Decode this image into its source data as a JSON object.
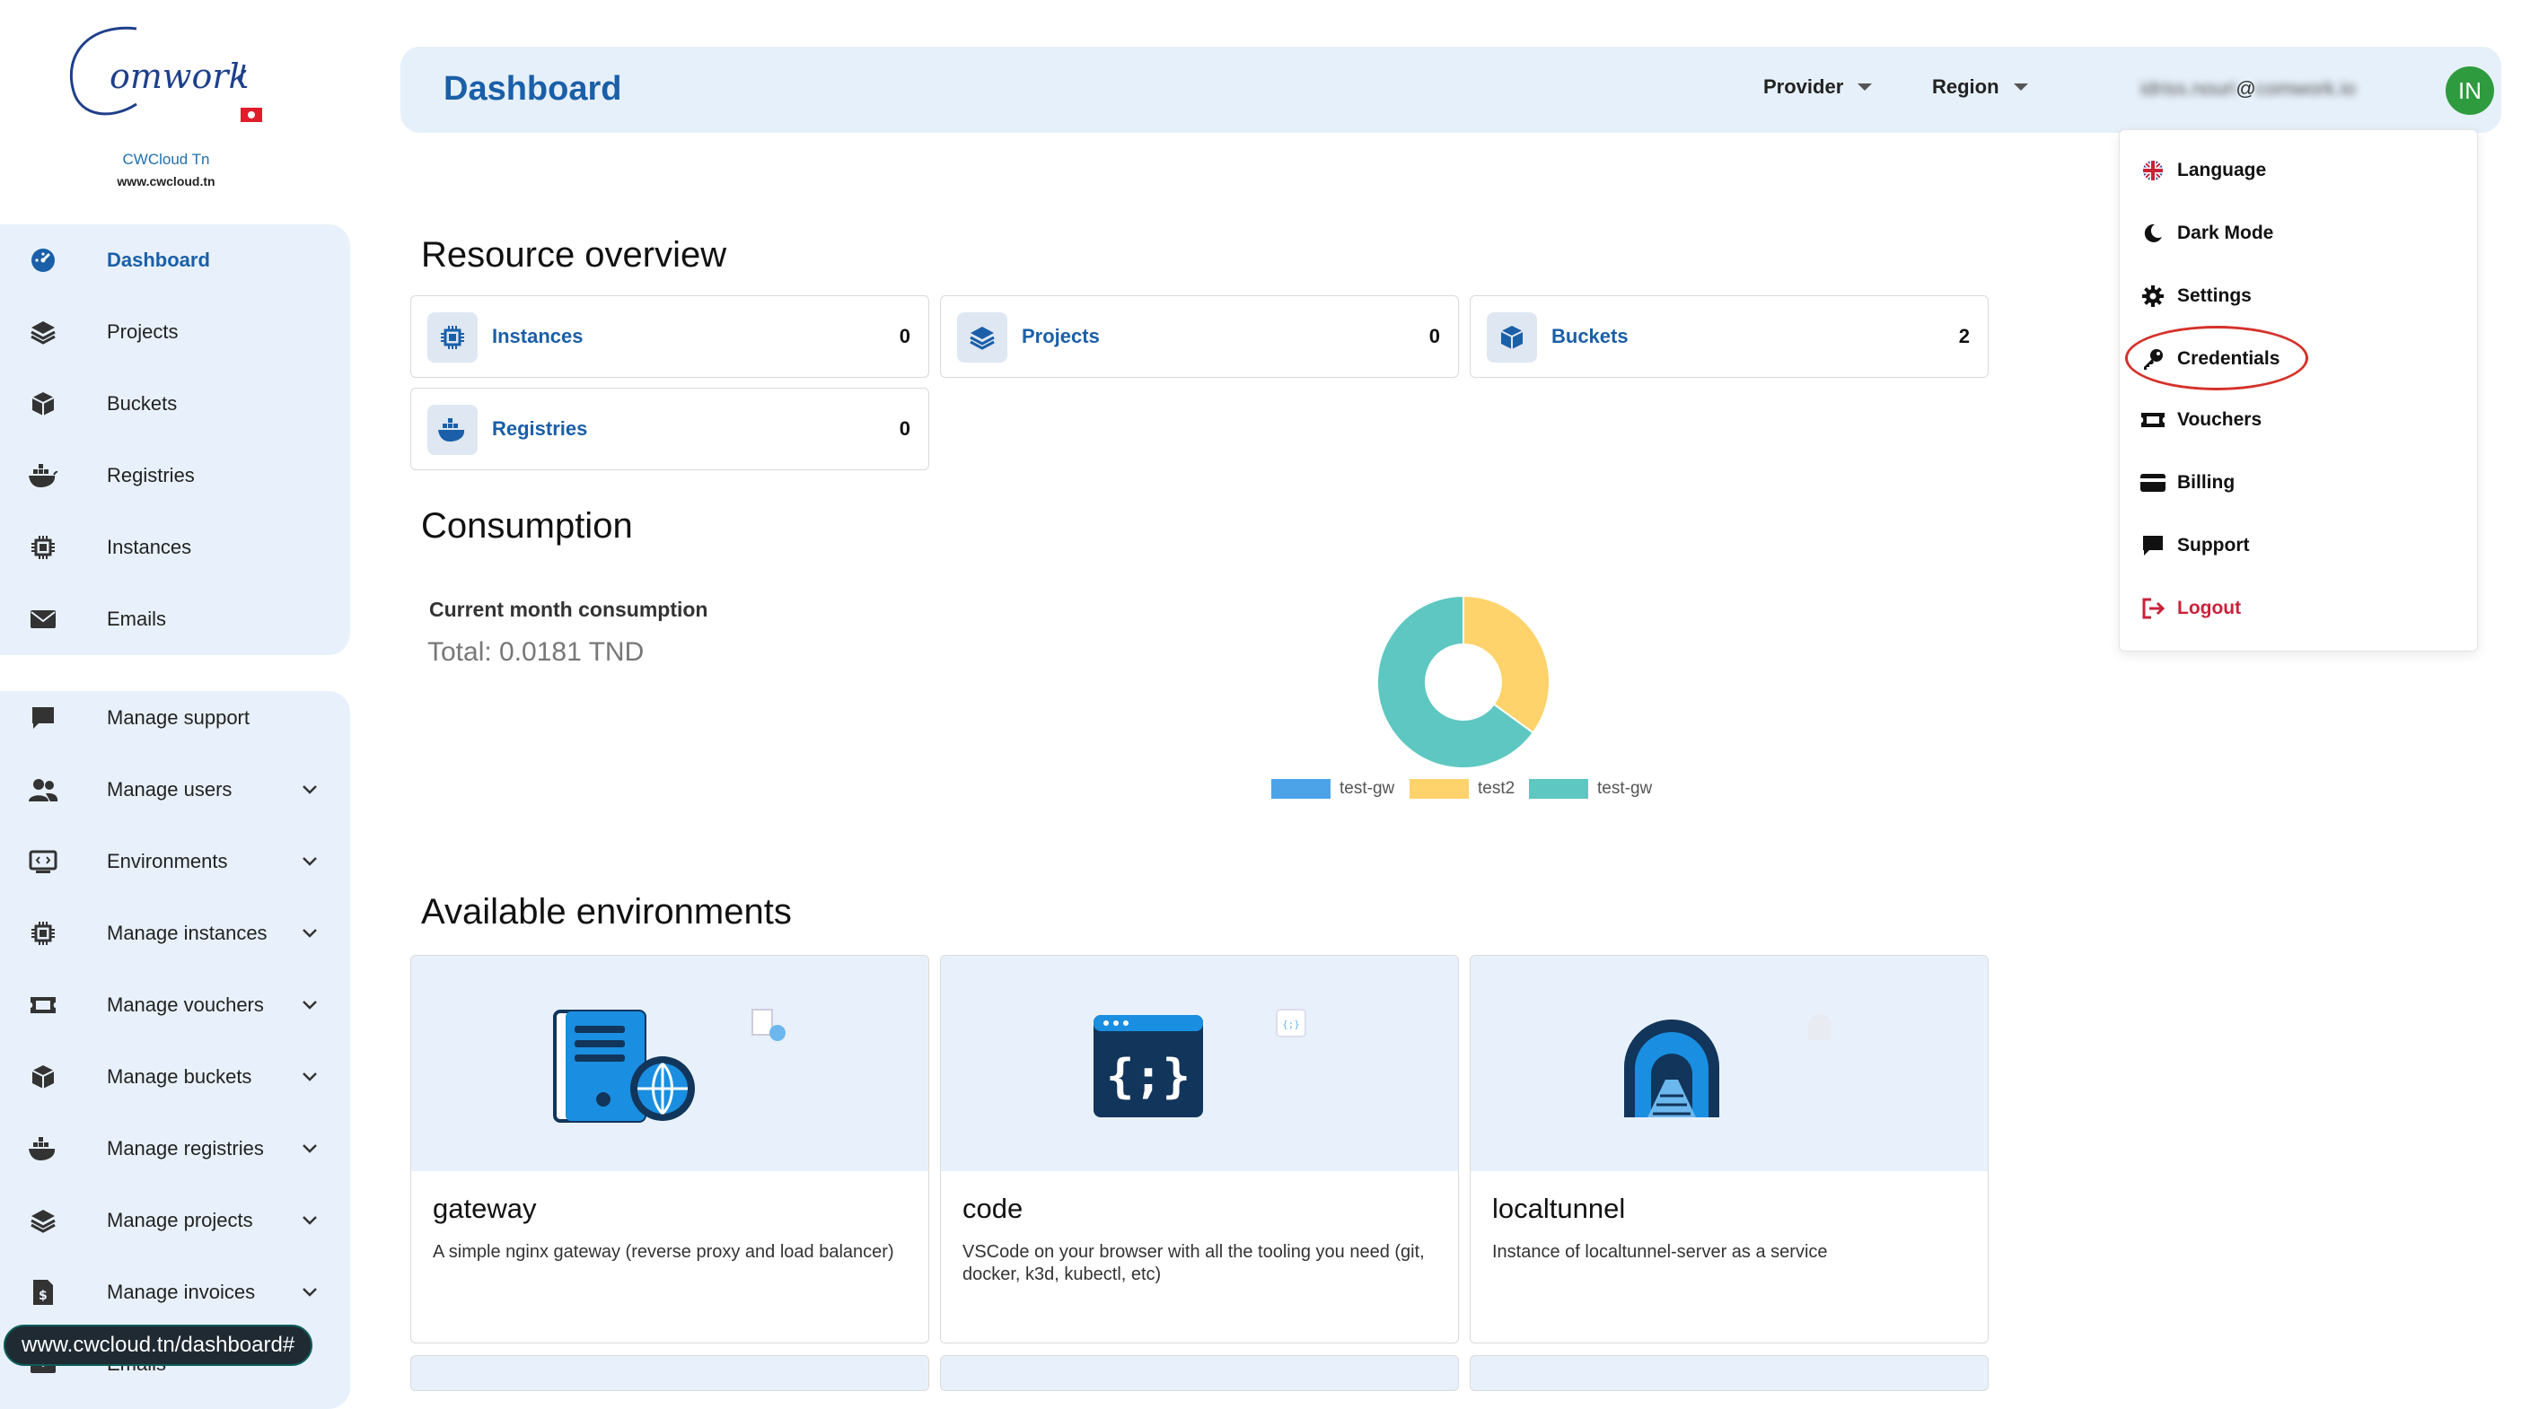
{
  "brand": {
    "logo_text": "Comwork",
    "name": "CWCloud Tn",
    "url": "www.cwcloud.tn"
  },
  "sidebar": {
    "primary": [
      {
        "label": "Dashboard",
        "icon": "dashboard-icon",
        "active": true
      },
      {
        "label": "Projects",
        "icon": "layers-icon"
      },
      {
        "label": "Buckets",
        "icon": "box-icon"
      },
      {
        "label": "Registries",
        "icon": "docker-icon"
      },
      {
        "label": "Instances",
        "icon": "cpu-icon"
      },
      {
        "label": "Emails",
        "icon": "envelope-icon"
      }
    ],
    "admin": [
      {
        "label": "Manage support",
        "icon": "chat-icon",
        "expandable": false
      },
      {
        "label": "Manage users",
        "icon": "users-icon",
        "expandable": true
      },
      {
        "label": "Environments",
        "icon": "code-window-icon",
        "expandable": true
      },
      {
        "label": "Manage instances",
        "icon": "cpu-icon",
        "expandable": true
      },
      {
        "label": "Manage vouchers",
        "icon": "ticket-icon",
        "expandable": true
      },
      {
        "label": "Manage buckets",
        "icon": "box-icon",
        "expandable": true
      },
      {
        "label": "Manage registries",
        "icon": "docker-icon",
        "expandable": true
      },
      {
        "label": "Manage projects",
        "icon": "layers-icon",
        "expandable": true
      },
      {
        "label": "Manage invoices",
        "icon": "invoice-icon",
        "expandable": true
      },
      {
        "label": "Emails",
        "icon": "envelope-icon",
        "expandable": false
      }
    ]
  },
  "status_url": "www.cwcloud.tn/dashboard#",
  "header": {
    "title": "Dashboard",
    "provider_label": "Provider",
    "region_label": "Region",
    "user_email_prefix": "idriss.nouri",
    "user_email_at": "@",
    "user_email_domain": "comwork.io",
    "avatar_initials": "IN",
    "avatar_color": "#2e9b3e"
  },
  "user_menu": [
    {
      "label": "Language",
      "icon": "uk-flag-icon"
    },
    {
      "label": "Dark Mode",
      "icon": "moon-icon"
    },
    {
      "label": "Settings",
      "icon": "gear-icon"
    },
    {
      "label": "Credentials",
      "icon": "key-icon",
      "highlighted": true
    },
    {
      "label": "Vouchers",
      "icon": "ticket-icon"
    },
    {
      "label": "Billing",
      "icon": "credit-card-icon"
    },
    {
      "label": "Support",
      "icon": "chat-icon"
    },
    {
      "label": "Logout",
      "icon": "logout-icon",
      "color": "#c8233a"
    }
  ],
  "resource_overview": {
    "title": "Resource overview",
    "cards": [
      {
        "label": "Instances",
        "count": "0",
        "icon": "cpu-icon"
      },
      {
        "label": "Projects",
        "count": "0",
        "icon": "layers-icon"
      },
      {
        "label": "Buckets",
        "count": "2",
        "icon": "box-icon"
      },
      {
        "label": "Registries",
        "count": "0",
        "icon": "docker-icon"
      }
    ]
  },
  "consumption": {
    "title": "Consumption",
    "label": "Current month consumption",
    "total": "Total: 0.0181 TND"
  },
  "chart_data": {
    "type": "pie",
    "title": "",
    "categories": [
      "test-gw",
      "test2",
      "test-gw"
    ],
    "values": [
      0,
      0.35,
      0.65
    ],
    "colors": [
      "#4da3e8",
      "#ffd36b",
      "#5ec7c2"
    ],
    "donut": true,
    "legend": "bottom"
  },
  "environments": {
    "title": "Available environments",
    "items": [
      {
        "name": "gateway",
        "description": "A simple nginx gateway (reverse proxy and load balancer)",
        "icon": "server-globe-icon"
      },
      {
        "name": "code",
        "description": "VSCode on your browser with all the tooling you need (git, docker, k3d, kubectl, etc)",
        "icon": "code-braces-icon"
      },
      {
        "name": "localtunnel",
        "description": "Instance of localtunnel-server as a service",
        "icon": "tunnel-icon"
      }
    ]
  },
  "colors": {
    "accent": "#1a5fa8",
    "sidebar_bg": "#e8f1fb",
    "logout": "#c8233a",
    "highlight": "#d4322a"
  }
}
